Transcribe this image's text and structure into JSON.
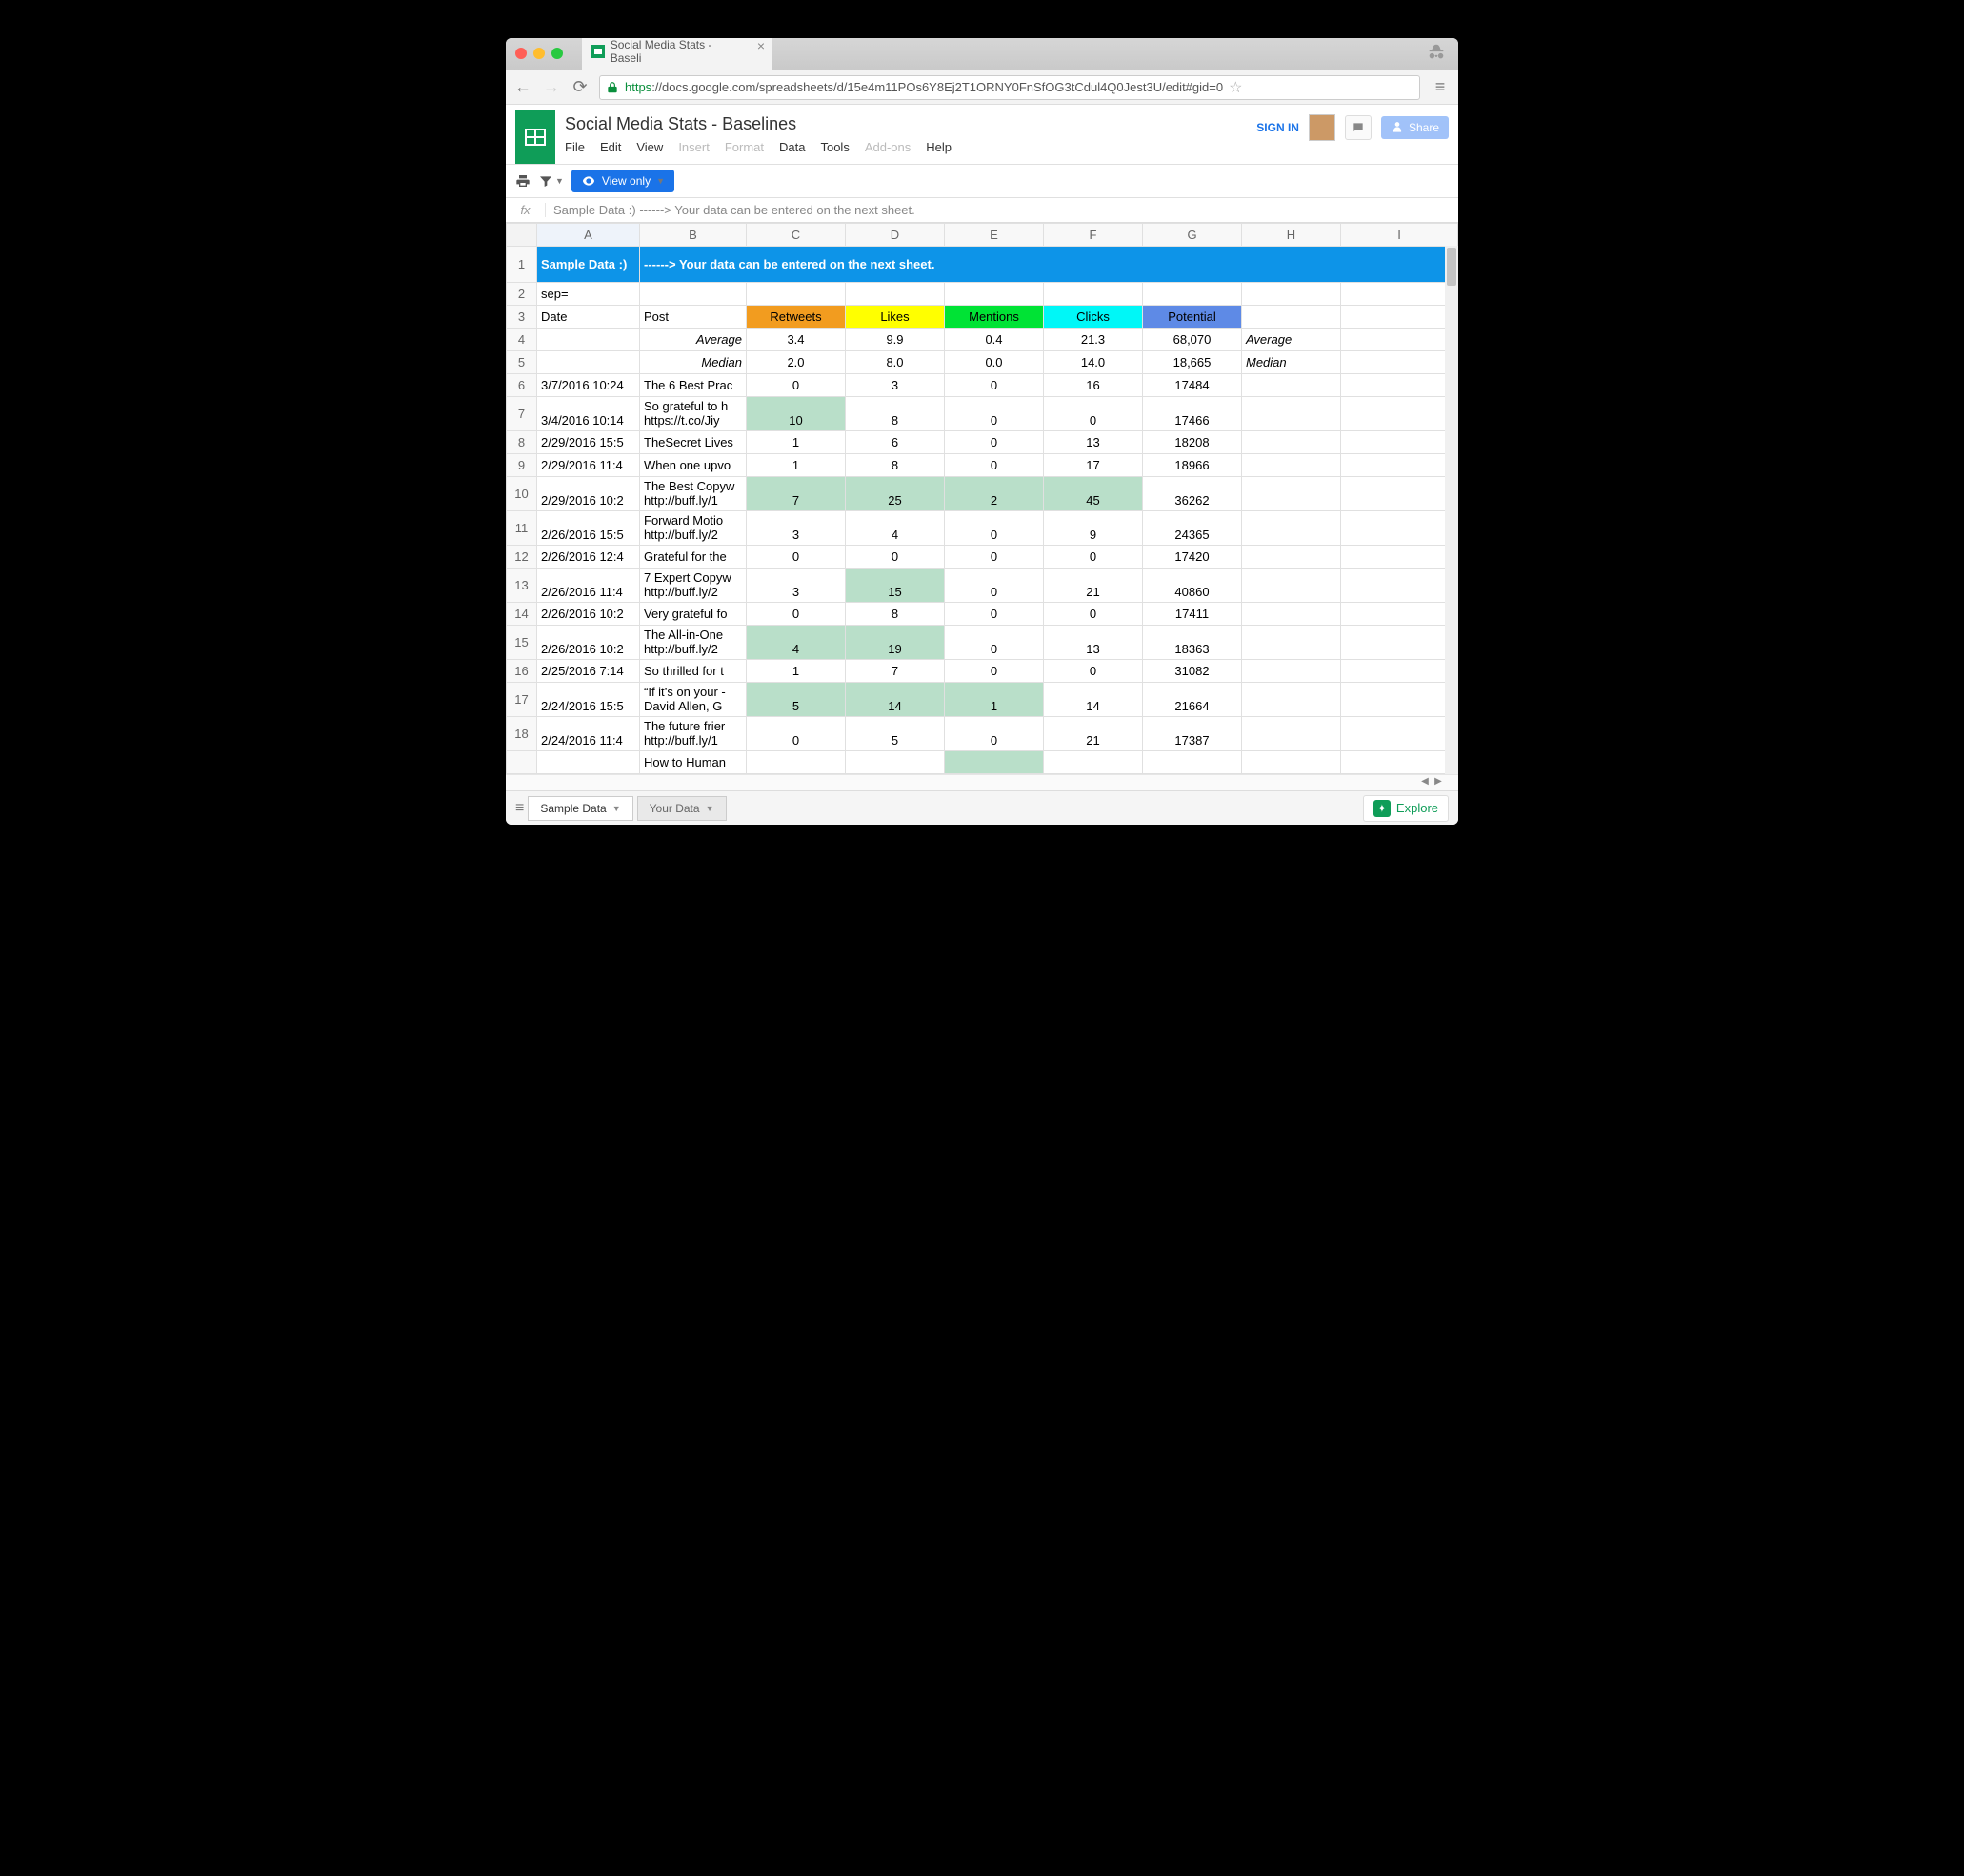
{
  "browser": {
    "tab_title": "Social Media Stats - Baseli",
    "url_https": "https",
    "url_rest": "://docs.google.com/spreadsheets/d/15e4m11POs6Y8Ej2T1ORNY0FnSfOG3tCdul4Q0Jest3U/edit#gid=0"
  },
  "docs": {
    "title": "Social Media Stats - Baselines",
    "menus": [
      "File",
      "Edit",
      "View",
      "Insert",
      "Format",
      "Data",
      "Tools",
      "Add-ons",
      "Help"
    ],
    "menus_disabled": [
      "Insert",
      "Format",
      "Add-ons"
    ],
    "signin": "SIGN IN",
    "share": "Share",
    "view_only": "View only"
  },
  "formula_bar": "Sample Data :) ------> Your data can be entered on the next sheet.",
  "columns": [
    "A",
    "B",
    "C",
    "D",
    "E",
    "F",
    "G",
    "H",
    "I"
  ],
  "headers_row": {
    "date": "Date",
    "post": "Post",
    "retweets": "Retweets",
    "likes": "Likes",
    "mentions": "Mentions",
    "clicks": "Clicks",
    "potential": "Potential"
  },
  "banner": {
    "a": "Sample Data :)",
    "rest": "------> Your data can be entered on the next sheet."
  },
  "row2_a": "sep=",
  "avg_row": {
    "label": "Average",
    "retweets": "3.4",
    "likes": "9.9",
    "mentions": "0.4",
    "clicks": "21.3",
    "potential": "68,070",
    "label2": "Average"
  },
  "med_row": {
    "label": "Median",
    "retweets": "2.0",
    "likes": "8.0",
    "mentions": "0.0",
    "clicks": "14.0",
    "potential": "18,665",
    "label2": "Median"
  },
  "rows": [
    {
      "n": 6,
      "date": "3/7/2016 10:24",
      "post": "The 6 Best Prac",
      "rt": "0",
      "lk": "3",
      "mn": "0",
      "cl": "16",
      "pt": "17484",
      "hl": []
    },
    {
      "n": 7,
      "date": "3/4/2016 10:14",
      "post": "So grateful to h\nhttps://t.co/Jiy",
      "rt": "10",
      "lk": "8",
      "mn": "0",
      "cl": "0",
      "pt": "17466",
      "hl": [
        "rt"
      ],
      "tall": true
    },
    {
      "n": 8,
      "date": "2/29/2016 15:5",
      "post": "TheSecret Lives",
      "rt": "1",
      "lk": "6",
      "mn": "0",
      "cl": "13",
      "pt": "18208",
      "hl": []
    },
    {
      "n": 9,
      "date": "2/29/2016 11:4",
      "post": "When one upvo",
      "rt": "1",
      "lk": "8",
      "mn": "0",
      "cl": "17",
      "pt": "18966",
      "hl": []
    },
    {
      "n": 10,
      "date": "2/29/2016 10:2",
      "post": "The Best Copyw\nhttp://buff.ly/1",
      "rt": "7",
      "lk": "25",
      "mn": "2",
      "cl": "45",
      "pt": "36262",
      "hl": [
        "rt",
        "lk",
        "mn",
        "cl"
      ],
      "tall": true
    },
    {
      "n": 11,
      "date": "2/26/2016 15:5",
      "post": "Forward Motio\nhttp://buff.ly/2",
      "rt": "3",
      "lk": "4",
      "mn": "0",
      "cl": "9",
      "pt": "24365",
      "hl": [],
      "tall": true
    },
    {
      "n": 12,
      "date": "2/26/2016 12:4",
      "post": "Grateful for the",
      "rt": "0",
      "lk": "0",
      "mn": "0",
      "cl": "0",
      "pt": "17420",
      "hl": []
    },
    {
      "n": 13,
      "date": "2/26/2016 11:4",
      "post": "7 Expert Copyw\nhttp://buff.ly/2",
      "rt": "3",
      "lk": "15",
      "mn": "0",
      "cl": "21",
      "pt": "40860",
      "hl": [
        "lk"
      ],
      "tall": true
    },
    {
      "n": 14,
      "date": "2/26/2016 10:2",
      "post": "Very grateful fo",
      "rt": "0",
      "lk": "8",
      "mn": "0",
      "cl": "0",
      "pt": "17411",
      "hl": []
    },
    {
      "n": 15,
      "date": "2/26/2016 10:2",
      "post": "The All-in-One \nhttp://buff.ly/2",
      "rt": "4",
      "lk": "19",
      "mn": "0",
      "cl": "13",
      "pt": "18363",
      "hl": [
        "rt",
        "lk"
      ],
      "tall": true
    },
    {
      "n": 16,
      "date": "2/25/2016 7:14",
      "post": "So thrilled for t",
      "rt": "1",
      "lk": "7",
      "mn": "0",
      "cl": "0",
      "pt": "31082",
      "hl": []
    },
    {
      "n": 17,
      "date": "2/24/2016 15:5",
      "post": "“If it’s on your \n- David Allen, G",
      "rt": "5",
      "lk": "14",
      "mn": "1",
      "cl": "14",
      "pt": "21664",
      "hl": [
        "rt",
        "lk",
        "mn"
      ],
      "tall": true
    },
    {
      "n": 18,
      "date": "2/24/2016 11:4",
      "post": "The future frier\nhttp://buff.ly/1",
      "rt": "0",
      "lk": "5",
      "mn": "0",
      "cl": "21",
      "pt": "17387",
      "hl": [],
      "tall": true
    },
    {
      "n": "",
      "date": "",
      "post": "How to Human",
      "rt": "",
      "lk": "",
      "mn": "",
      "cl": "",
      "pt": "",
      "hl": [
        "mn"
      ]
    }
  ],
  "sheet_tabs": {
    "active": "Sample Data",
    "other": "Your Data"
  },
  "explore": "Explore"
}
